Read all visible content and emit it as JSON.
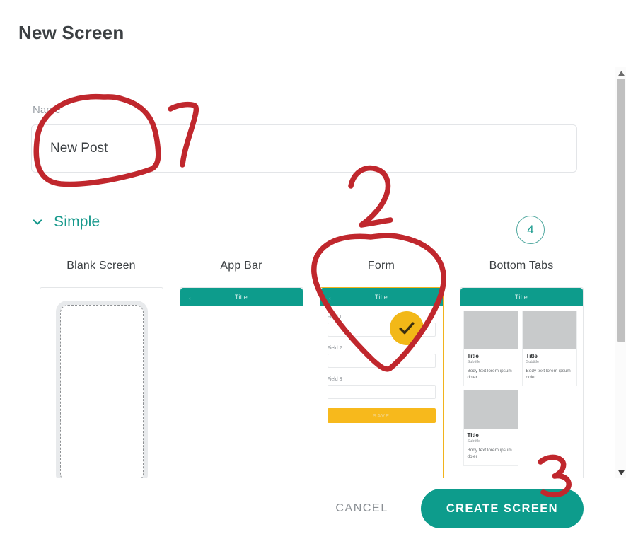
{
  "header": {
    "title": "New Screen"
  },
  "name_field": {
    "label": "Name",
    "value": "New Post",
    "placeholder": "Name"
  },
  "section": {
    "name": "Simple",
    "chevron_icon": "chevron-down-icon",
    "count": "4"
  },
  "templates": [
    {
      "caption": "Blank Screen",
      "type": "blank",
      "selected": false
    },
    {
      "caption": "App Bar",
      "type": "appbar",
      "selected": false,
      "appbar_title": "Title",
      "back_icon": "arrow-left-icon"
    },
    {
      "caption": "Form",
      "type": "form",
      "selected": true,
      "appbar_title": "Title",
      "back_icon": "arrow-left-icon",
      "fields": [
        "Field 1",
        "Field 2",
        "Field 3"
      ],
      "save_label": "SAVE",
      "check_icon": "check-icon"
    },
    {
      "caption": "Bottom Tabs",
      "type": "bottomtabs",
      "selected": false,
      "appbar_title": "Title",
      "cards": [
        {
          "title": "Title",
          "subtitle": "Subtitle",
          "body": "Body text lorem ipsum doler"
        },
        {
          "title": "Title",
          "subtitle": "Subtitle",
          "body": "Body text lorem ipsum doler"
        },
        {
          "title": "Title",
          "subtitle": "Subtitle",
          "body": "Body text lorem ipsum doler"
        }
      ]
    }
  ],
  "footer": {
    "cancel_label": "CANCEL",
    "create_label": "CREATE SCREEN"
  },
  "annotations": [
    {
      "label": "1",
      "target": "name-field"
    },
    {
      "label": "2",
      "target": "form-template-card"
    },
    {
      "label": "3",
      "target": "create-screen-button"
    }
  ],
  "colors": {
    "teal": "#0d9c8c",
    "amber": "#f2b818",
    "annotation_red": "#c0272d",
    "section_text": "#17998c"
  },
  "scrollbar": {
    "up_icon": "scroll-up-arrow-icon",
    "down_icon": "scroll-down-arrow-icon"
  }
}
